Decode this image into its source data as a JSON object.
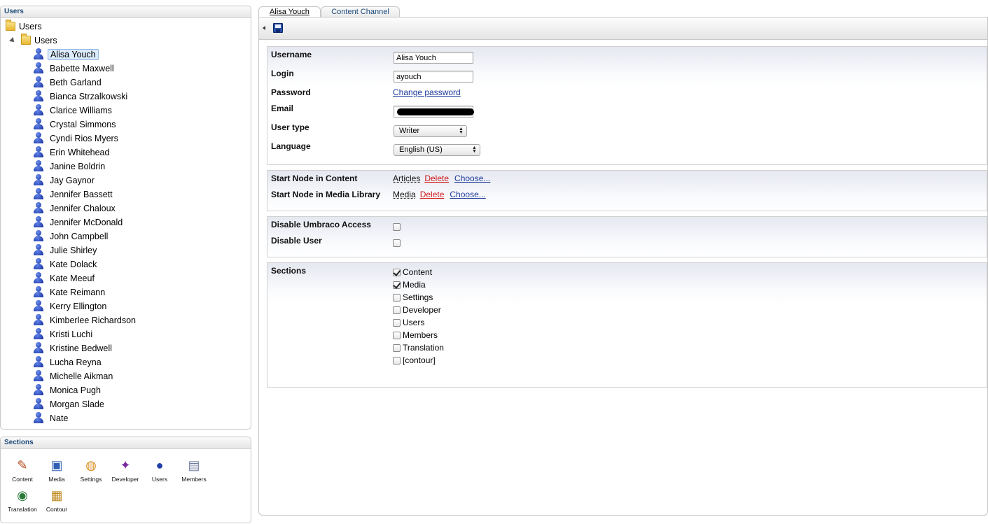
{
  "users_panel": {
    "title": "Users",
    "root_label": "Users",
    "folder_label": "Users",
    "users": [
      "Alisa Youch",
      "Babette Maxwell",
      "Beth Garland",
      "Bianca Strzalkowski",
      "Clarice Williams",
      "Crystal Simmons",
      "Cyndi Rios Myers",
      "Erin Whitehead",
      "Janine Boldrin",
      "Jay Gaynor",
      "Jennifer Bassett",
      "Jennifer Chaloux",
      "Jennifer McDonald",
      "John Campbell",
      "Julie Shirley",
      "Kate Dolack",
      "Kate Meeuf",
      "Kate Reimann",
      "Kerry Ellington",
      "Kimberlee Richardson",
      "Kristi Luchi",
      "Kristine Bedwell",
      "Lucha Reyna",
      "Michelle Aikman",
      "Monica Pugh",
      "Morgan Slade",
      "Nate"
    ],
    "selected_user": "Alisa Youch"
  },
  "sections_panel": {
    "title": "Sections",
    "items": [
      {
        "label": "Content",
        "icon": "content-edit-icon"
      },
      {
        "label": "Media",
        "icon": "media-picture-icon"
      },
      {
        "label": "Settings",
        "icon": "settings-color-wheel-icon"
      },
      {
        "label": "Developer",
        "icon": "developer-wand-icon"
      },
      {
        "label": "Users",
        "icon": "users-person-icon"
      },
      {
        "label": "Members",
        "icon": "members-card-icon"
      },
      {
        "label": "Translation",
        "icon": "translation-globe-icon"
      },
      {
        "label": "Contour",
        "icon": "contour-form-icon"
      }
    ]
  },
  "tabs": [
    {
      "label": "Alisa Youch",
      "active": true
    },
    {
      "label": "Content Channel",
      "active": false
    }
  ],
  "user_form": {
    "username_label": "Username",
    "username_value": "Alisa Youch",
    "login_label": "Login",
    "login_value": "ayouch",
    "password_label": "Password",
    "change_password_link": "Change password",
    "email_label": "Email",
    "user_type_label": "User type",
    "user_type_value": "Writer",
    "language_label": "Language",
    "language_value": "English (US)"
  },
  "start_nodes": {
    "content_label": "Start Node in Content",
    "content_node": "Articles",
    "media_label": "Start Node in Media Library",
    "media_node": "Media",
    "delete_label": "Delete",
    "choose_label": "Choose..."
  },
  "access": {
    "disable_umbraco_label": "Disable Umbraco Access",
    "disable_umbraco_checked": false,
    "disable_user_label": "Disable User",
    "disable_user_checked": false
  },
  "sections_form": {
    "label": "Sections",
    "options": [
      {
        "label": "Content",
        "checked": true
      },
      {
        "label": "Media",
        "checked": true
      },
      {
        "label": "Settings",
        "checked": false
      },
      {
        "label": "Developer",
        "checked": false
      },
      {
        "label": "Users",
        "checked": false
      },
      {
        "label": "Members",
        "checked": false
      },
      {
        "label": "Translation",
        "checked": false
      },
      {
        "label": "[contour]",
        "checked": false
      }
    ]
  },
  "colors": {
    "link": "#1c3a9a",
    "delete_link": "#d01818",
    "panel_heading": "#1d4a7a",
    "selection": "#dcebfb"
  }
}
